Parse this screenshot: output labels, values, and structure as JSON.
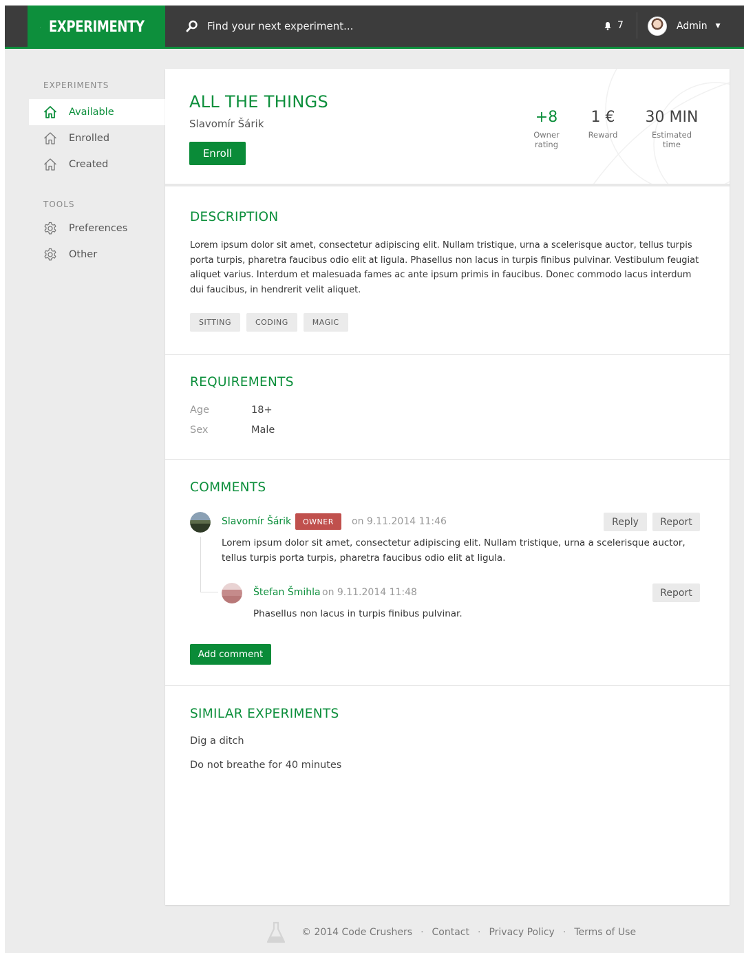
{
  "app": {
    "name": "EXPERIMENTY"
  },
  "search": {
    "placeholder": "Find your next experiment..."
  },
  "header": {
    "notification_count": "7",
    "user_name": "Admin"
  },
  "sidebar": {
    "experiments_heading": "EXPERIMENTS",
    "experiments_items": [
      {
        "label": "Available",
        "icon": "home-icon",
        "active": true
      },
      {
        "label": "Enrolled",
        "icon": "home-icon",
        "active": false
      },
      {
        "label": "Created",
        "icon": "home-icon",
        "active": false
      }
    ],
    "tools_heading": "TOOLS",
    "tools_items": [
      {
        "label": "Preferences",
        "icon": "gear-icon"
      },
      {
        "label": "Other",
        "icon": "gear-icon"
      }
    ]
  },
  "experiment": {
    "title": "ALL THE THINGS",
    "author": "Slavomír Šárik",
    "enroll_label": "Enroll",
    "stats": [
      {
        "value": "+8",
        "label": "Owner rating"
      },
      {
        "value": "1 €",
        "label": "Reward"
      },
      {
        "value": "30 MIN",
        "label": "Estimated time"
      }
    ]
  },
  "description": {
    "title": "DESCRIPTION",
    "text": "Lorem ipsum dolor sit amet, consectetur adipiscing elit. Nullam tristique, urna a scelerisque auctor, tellus turpis porta turpis, pharetra faucibus odio elit at ligula. Phasellus non lacus in turpis finibus pulvinar. Vestibulum feugiat aliquet varius. Interdum et malesuada fames ac ante ipsum primis in faucibus. Donec commodo lacus interdum dui faucibus, in hendrerit velit aliquet.",
    "tags": [
      "SITTING",
      "CODING",
      "MAGIC"
    ]
  },
  "requirements": {
    "title": "REQUIREMENTS",
    "rows": [
      {
        "label": "Age",
        "value": "18+"
      },
      {
        "label": "Sex",
        "value": "Male"
      }
    ]
  },
  "comments": {
    "title": "COMMENTS",
    "items": [
      {
        "author": "Slavomír Šárik",
        "badge": "OWNER",
        "date": "on 9.11.2014 11:46",
        "text": "Lorem ipsum dolor sit amet, consectetur adipiscing elit. Nullam tristique, urna a scelerisque auctor, tellus turpis porta turpis, pharetra faucibus odio elit at ligula.",
        "reply_label": "Reply",
        "report_label": "Report"
      },
      {
        "author": "Štefan Šmihla",
        "date": "on 9.11.2014 11:48",
        "text": "Phasellus non lacus in turpis finibus pulvinar.",
        "report_label": "Report"
      }
    ],
    "add_label": "Add comment"
  },
  "similar": {
    "title": "SIMILAR EXPERIMENTS",
    "items": [
      "Dig a ditch",
      "Do not breathe for 40 minutes"
    ]
  },
  "footer": {
    "copyright": "© 2014 Code Crushers",
    "separator": "·",
    "links": [
      "Contact",
      "Privacy Policy",
      "Terms of Use"
    ]
  },
  "colors": {
    "brand_green": "#0d8f3c",
    "topbar": "#3c3c3c",
    "owner_badge": "#c0504d"
  }
}
